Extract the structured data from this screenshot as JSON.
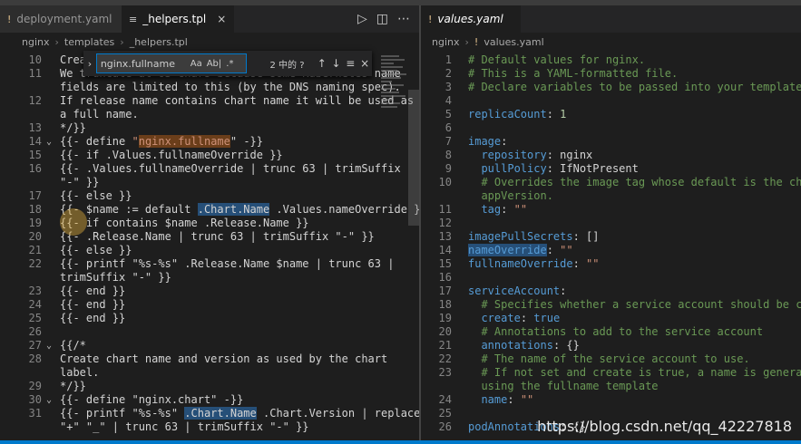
{
  "left": {
    "tabs": [
      {
        "icon": "!",
        "label": "deployment.yaml",
        "active": false
      },
      {
        "icon": "≡",
        "label": "_helpers.tpl",
        "active": true
      }
    ],
    "breadcrumb": [
      "nginx",
      "templates",
      "_helpers.tpl"
    ],
    "find": {
      "query": "nginx.fullname",
      "count": "2 中的 ?",
      "options": [
        "Aa",
        "Ab|",
        ".*"
      ]
    },
    "lines": [
      {
        "n": "10",
        "t": "Create a default fully qualified app name."
      },
      {
        "n": "11",
        "t": "We truncate at 63 chars because some Kubernetes name"
      },
      {
        "n": "",
        "t": "fields are limited to this (by the DNS naming spec)."
      },
      {
        "n": "12",
        "t": "If release name contains chart name it will be used as"
      },
      {
        "n": "",
        "t": "a full name."
      },
      {
        "n": "13",
        "t": "*/}}"
      },
      {
        "n": "14",
        "t": "{{- define \"nginx.fullname\" -}}"
      },
      {
        "n": "15",
        "t": "{{- if .Values.fullnameOverride }}"
      },
      {
        "n": "16",
        "t": "{{- .Values.fullnameOverride | trunc 63 | trimSuffix"
      },
      {
        "n": "",
        "t": "\"-\" }}"
      },
      {
        "n": "17",
        "t": "{{- else }}"
      },
      {
        "n": "18",
        "t": "{{- $name := default .Chart.Name .Values.nameOverride }}"
      },
      {
        "n": "19",
        "t": "{{- if contains $name .Release.Name }}"
      },
      {
        "n": "20",
        "t": "{{- .Release.Name | trunc 63 | trimSuffix \"-\" }}"
      },
      {
        "n": "21",
        "t": "{{- else }}"
      },
      {
        "n": "22",
        "t": "{{- printf \"%s-%s\" .Release.Name $name | trunc 63 |"
      },
      {
        "n": "",
        "t": "trimSuffix \"-\" }}"
      },
      {
        "n": "23",
        "t": "{{- end }}"
      },
      {
        "n": "24",
        "t": "{{- end }}"
      },
      {
        "n": "25",
        "t": "{{- end }}"
      },
      {
        "n": "26",
        "t": ""
      },
      {
        "n": "27",
        "t": "{{/*"
      },
      {
        "n": "28",
        "t": "Create chart name and version as used by the chart"
      },
      {
        "n": "",
        "t": "label."
      },
      {
        "n": "29",
        "t": "*/}}"
      },
      {
        "n": "30",
        "t": "{{- define \"nginx.chart\" -}}"
      },
      {
        "n": "31",
        "t": "{{- printf \"%s-%s\" .Chart.Name .Chart.Version | replace"
      },
      {
        "n": "",
        "t": "\"+\" \"_\" | trunc 63 | trimSuffix \"-\" }}"
      }
    ]
  },
  "right": {
    "tabs": [
      {
        "icon": "!",
        "label": "values.yaml",
        "active": true
      }
    ],
    "breadcrumb": [
      "nginx",
      "values.yaml"
    ],
    "lines": [
      {
        "n": "1",
        "t": "# Default values for nginx.",
        "c": true
      },
      {
        "n": "2",
        "t": "# This is a YAML-formatted file.",
        "c": true
      },
      {
        "n": "3",
        "t": "# Declare variables to be passed into your templates.",
        "c": true
      },
      {
        "n": "4",
        "t": ""
      },
      {
        "n": "5",
        "k": "replicaCount",
        "v": " 1",
        "vt": "n"
      },
      {
        "n": "6",
        "t": ""
      },
      {
        "n": "7",
        "k": "image",
        "v": ""
      },
      {
        "n": "8",
        "k": "  repository",
        "v": " nginx"
      },
      {
        "n": "9",
        "k": "  pullPolicy",
        "v": " IfNotPresent"
      },
      {
        "n": "10",
        "t": "  # Overrides the image tag whose default is the chart",
        "c": true
      },
      {
        "n": "",
        "t": "  appVersion.",
        "c": true
      },
      {
        "n": "11",
        "k": "  tag",
        "v": " \"\"",
        "vt": "s"
      },
      {
        "n": "12",
        "t": ""
      },
      {
        "n": "13",
        "k": "imagePullSecrets",
        "v": " []"
      },
      {
        "n": "14",
        "k": "nameOverride",
        "v": " \"\"",
        "vt": "s",
        "hl": true
      },
      {
        "n": "15",
        "k": "fullnameOverride",
        "v": " \"\"",
        "vt": "s"
      },
      {
        "n": "16",
        "t": ""
      },
      {
        "n": "17",
        "k": "serviceAccount",
        "v": ""
      },
      {
        "n": "18",
        "t": "  # Specifies whether a service account should be created",
        "c": true
      },
      {
        "n": "19",
        "k": "  create",
        "v": " true",
        "vt": "k"
      },
      {
        "n": "20",
        "t": "  # Annotations to add to the service account",
        "c": true
      },
      {
        "n": "21",
        "k": "  annotations",
        "v": " {}"
      },
      {
        "n": "22",
        "t": "  # The name of the service account to use.",
        "c": true
      },
      {
        "n": "23",
        "t": "  # If not set and create is true, a name is generated",
        "c": true
      },
      {
        "n": "",
        "t": "  using the fullname template",
        "c": true
      },
      {
        "n": "24",
        "k": "  name",
        "v": " \"\"",
        "vt": "s"
      },
      {
        "n": "25",
        "t": ""
      },
      {
        "n": "26",
        "k": "podAnnotations",
        "v": " {}"
      }
    ]
  },
  "watermark": "https://blog.csdn.net/qq_42227818",
  "colors": {
    "keyword": "#569cd6",
    "comment": "#6a9955",
    "string": "#ce9178",
    "accent": "#007acc"
  }
}
